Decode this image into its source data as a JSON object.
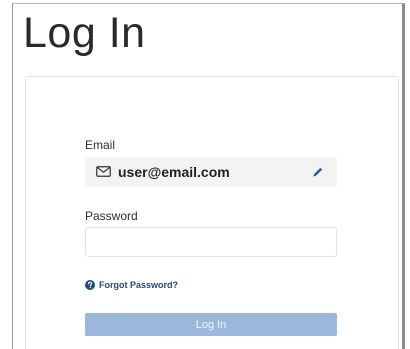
{
  "page": {
    "title": "Log In"
  },
  "form": {
    "email_label": "Email",
    "email_value": "user@email.com",
    "password_label": "Password",
    "password_value": "",
    "forgot_password_text": "Forgot Password?",
    "login_button_label": "Log In",
    "login_button_state": "disabled"
  },
  "colors": {
    "button_bg": "#9bb7dc",
    "link": "#234a7a",
    "edit_icon": "#2b5aa8"
  },
  "icons": {
    "email": "envelope-icon",
    "edit": "pencil-icon",
    "help": "question-circle-icon"
  }
}
